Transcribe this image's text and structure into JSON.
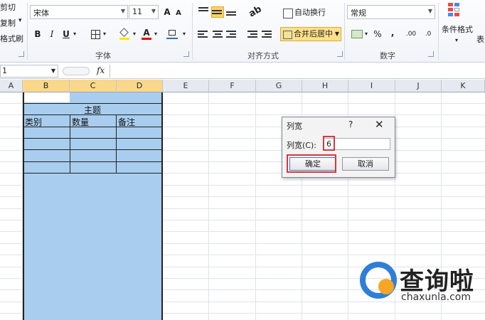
{
  "ribbon": {
    "clipboard": {
      "cut": "剪切",
      "copy": "复制",
      "copy_arrow": "▾",
      "format_painter": "格式刷"
    },
    "font": {
      "name": "宋体",
      "size": "11",
      "grow": "A",
      "shrink": "A",
      "bold": "B",
      "italic": "I",
      "underline": "U",
      "underline_arrow": "▾",
      "border": "▾",
      "fill": "▾",
      "color_a": "A",
      "color_arrow": "▾",
      "phonetic": "▾",
      "group_label": "字体"
    },
    "alignment": {
      "wrap": "自动换行",
      "merge": "合并后居中",
      "group_label": "对齐方式"
    },
    "number": {
      "format": "常规",
      "percent": "%",
      "comma": ",",
      "inc_decimal": ".00",
      "dec_decimal": ".0",
      "group_label": "数字"
    },
    "styles": {
      "cond_format": "条件格式",
      "table_partial": "表"
    }
  },
  "formula_bar": {
    "name_box": "1",
    "fx": "fx",
    "value": ""
  },
  "columns": [
    "A",
    "B",
    "C",
    "D",
    "E",
    "F",
    "G",
    "H",
    "I",
    "J",
    "K"
  ],
  "selected_columns": [
    "B",
    "C",
    "D"
  ],
  "table": {
    "title": "主题",
    "headers": [
      "类别",
      "数量",
      "备注"
    ]
  },
  "dialog": {
    "title": "列宽",
    "help": "?",
    "close": "✕",
    "label": "列宽(C):",
    "value": "6",
    "ok": "确定",
    "cancel": "取消"
  },
  "watermark": {
    "brand": "查询啦",
    "url": "chaxunla.com"
  },
  "colors": {
    "selection": "#a8cdef",
    "highlight": "#d6383c",
    "merge_active": "#ffe18a"
  }
}
